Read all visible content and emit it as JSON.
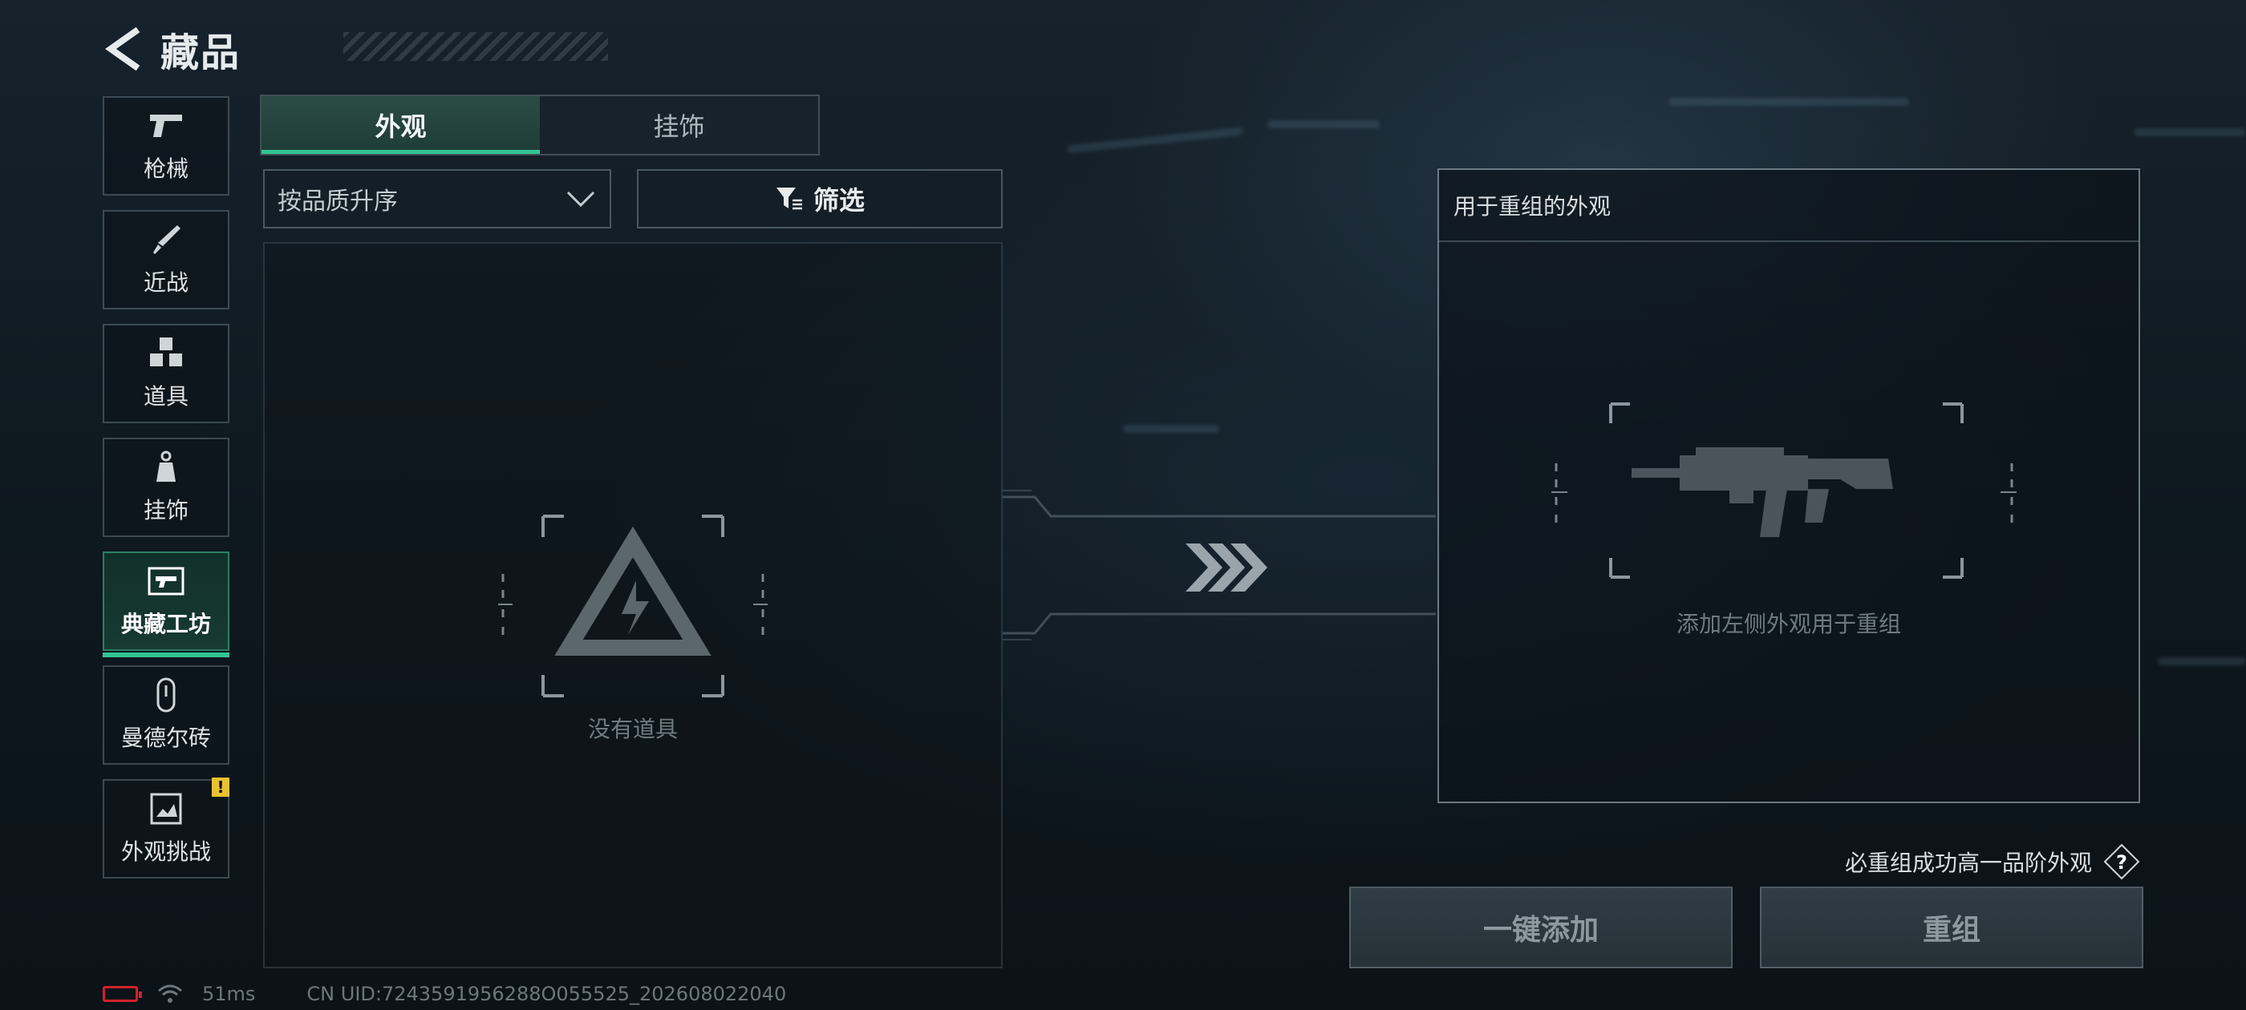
{
  "header": {
    "title": "藏品"
  },
  "nav": {
    "items": [
      {
        "label": "枪械"
      },
      {
        "label": "近战"
      },
      {
        "label": "道具"
      },
      {
        "label": "挂饰"
      },
      {
        "label": "典藏工坊",
        "active": true
      },
      {
        "label": "曼德尔砖"
      },
      {
        "label": "外观挑战",
        "badge": "!"
      }
    ]
  },
  "tabs": [
    {
      "label": "外观",
      "active": true
    },
    {
      "label": "挂饰"
    }
  ],
  "toolbar": {
    "sort_label": "按品质升序",
    "filter_label": "筛选"
  },
  "items_panel": {
    "empty_text": "没有道具"
  },
  "recompose": {
    "header": "用于重组的外观",
    "hint": "添加左侧外观用于重组",
    "guarantee_text": "必重组成功高一品阶外观",
    "add_all_label": "一键添加",
    "recompose_label": "重组"
  },
  "status": {
    "latency": "51ms",
    "uid": "CN UID:7243591956288O055525_202608022040"
  },
  "colors": {
    "accent": "#33c493",
    "badge": "#e9c231",
    "battery": "#d0222b"
  }
}
